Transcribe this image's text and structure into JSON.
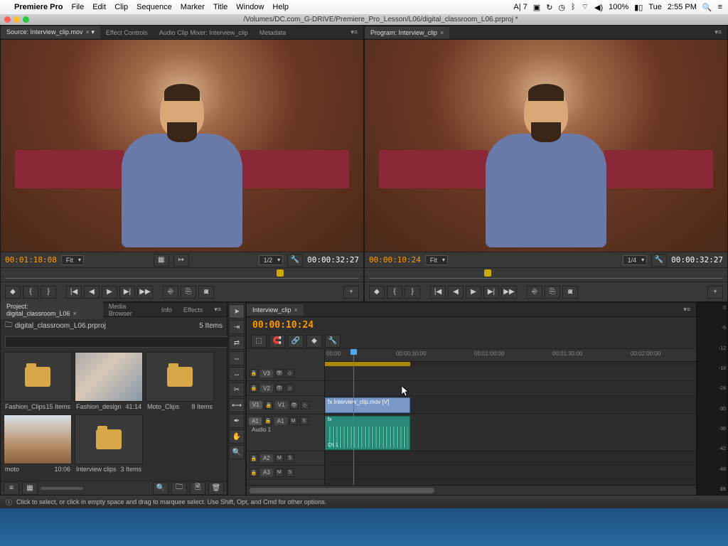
{
  "menubar": {
    "apple": "",
    "app": "Premiere Pro",
    "items": [
      "File",
      "Edit",
      "Clip",
      "Sequence",
      "Marker",
      "Title",
      "Window",
      "Help"
    ],
    "right": {
      "adobe_badge": "A| 7",
      "battery": "100%",
      "day": "Tue",
      "time": "2:55 PM"
    }
  },
  "titlebar": {
    "path": "/Volumes/DC.com_G-DRIVE/Premiere_Pro_Lesson/L06/digital_classroom_L06.prproj *"
  },
  "source_panel": {
    "tabs": [
      {
        "label": "Source: Interview_clip.mov",
        "active": true,
        "closable": true
      },
      {
        "label": "Effect Controls",
        "active": false
      },
      {
        "label": "Audio Clip Mixer: Interview_clip",
        "active": false
      },
      {
        "label": "Metadata",
        "active": false
      }
    ],
    "tc_in": "00:01:18:08",
    "fit": "Fit",
    "zoom": "1/2",
    "tc_out": "00:00:32:27"
  },
  "program_panel": {
    "tabs": [
      {
        "label": "Program: Interview_clip",
        "active": true,
        "closable": true
      }
    ],
    "tc_in": "00:00:10:24",
    "fit": "Fit",
    "zoom": "1/4",
    "tc_out": "00:00:32:27"
  },
  "project_panel": {
    "tabs": [
      {
        "label": "Project: digital_classroom_L06",
        "active": true,
        "closable": true
      },
      {
        "label": "Media Browser",
        "active": false
      },
      {
        "label": "Info",
        "active": false
      },
      {
        "label": "Effects",
        "active": false
      }
    ],
    "project_name": "digital_classroom_L06.prproj",
    "item_count": "5 Items",
    "search_placeholder": "",
    "bins": [
      {
        "name": "Fashion_Clips",
        "meta": "15 Items",
        "type": "folder"
      },
      {
        "name": "Fashion_design",
        "meta": "41:14",
        "type": "img1"
      },
      {
        "name": "Moto_Clips",
        "meta": "8 Items",
        "type": "folder"
      },
      {
        "name": "moto",
        "meta": "10:06",
        "type": "img2"
      },
      {
        "name": "Interview clips",
        "meta": "3 Items",
        "type": "folder"
      }
    ]
  },
  "tools": [
    "selection",
    "track-select",
    "ripple",
    "rolling",
    "rate",
    "razor",
    "slip",
    "pen",
    "hand",
    "zoom"
  ],
  "timeline": {
    "tab": "Interview_clip",
    "tc": "00:00:10:24",
    "ruler": [
      "00:00",
      "00:00:30:00",
      "00:01:00:00",
      "00:01:30:00",
      "00:02:00:00"
    ],
    "tracks_v": [
      "V3",
      "V2",
      "V1"
    ],
    "tracks_a": [
      "A1",
      "A2",
      "A3"
    ],
    "a1_label": "Audio 1",
    "clip_v_name": "Interview_clip.mov [V]",
    "clip_a_ch": "Ch 1"
  },
  "audio_meter": {
    "scale": [
      "0",
      "-6",
      "-12",
      "-18",
      "-24",
      "-30",
      "-36",
      "-42",
      "-48",
      "dB"
    ]
  },
  "status": {
    "hint": "Click to select, or click in empty space and drag to marquee select. Use Shift, Opt, and Cmd for other options."
  },
  "transport_icons": [
    "◆",
    "{",
    "}",
    "|◀",
    "◀",
    "▶",
    "▶|",
    "▶▶",
    "⎆",
    "⎘",
    "⎙",
    "◙"
  ]
}
